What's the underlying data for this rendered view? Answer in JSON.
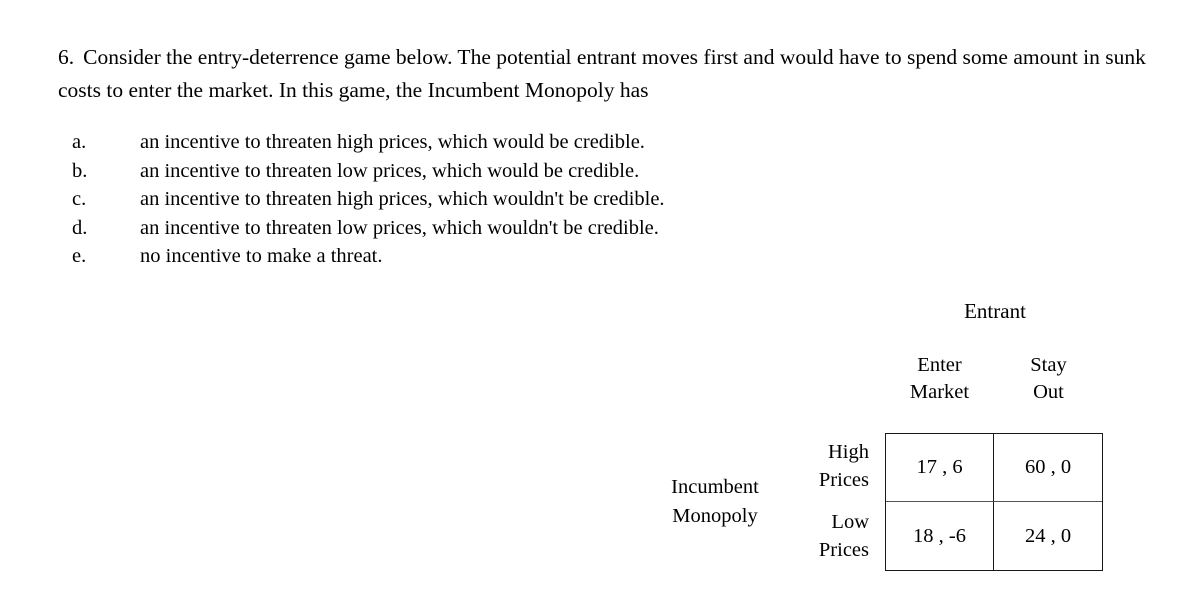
{
  "question": {
    "number": "6.",
    "text": "Consider the entry-deterrence game below. The potential entrant moves first and would have to spend some amount in sunk costs to enter the market. In this game, the Incumbent Monopoly has"
  },
  "options": [
    {
      "letter": "a.",
      "text": "an incentive to threaten high prices, which would be credible."
    },
    {
      "letter": "b.",
      "text": "an incentive to threaten low prices, which would be credible."
    },
    {
      "letter": "c.",
      "text": "an incentive to threaten high prices, which wouldn't be credible."
    },
    {
      "letter": "d.",
      "text": "an incentive to threaten low prices, which wouldn't be credible."
    },
    {
      "letter": "e.",
      "text": "no incentive to make a threat."
    }
  ],
  "chart_data": {
    "type": "table",
    "title": "",
    "column_player": "Entrant",
    "row_player_line1": "Incumbent",
    "row_player_line2": "Monopoly",
    "columns": [
      {
        "line1": "Enter",
        "line2": "Market"
      },
      {
        "line1": "Stay",
        "line2": "Out"
      }
    ],
    "rows": [
      {
        "line1": "High",
        "line2": "Prices"
      },
      {
        "line1": "Low",
        "line2": "Prices"
      }
    ],
    "cells": [
      [
        "17 , 6",
        "60 , 0"
      ],
      [
        "18 , -6",
        "24 , 0"
      ]
    ],
    "payoffs": [
      [
        {
          "row_player": 17,
          "col_player": 6
        },
        {
          "row_player": 60,
          "col_player": 0
        }
      ],
      [
        {
          "row_player": 18,
          "col_player": -6
        },
        {
          "row_player": 24,
          "col_player": 0
        }
      ]
    ],
    "border_color": "#1a1a1a",
    "text_color": "#000000",
    "background": "#ffffff"
  }
}
